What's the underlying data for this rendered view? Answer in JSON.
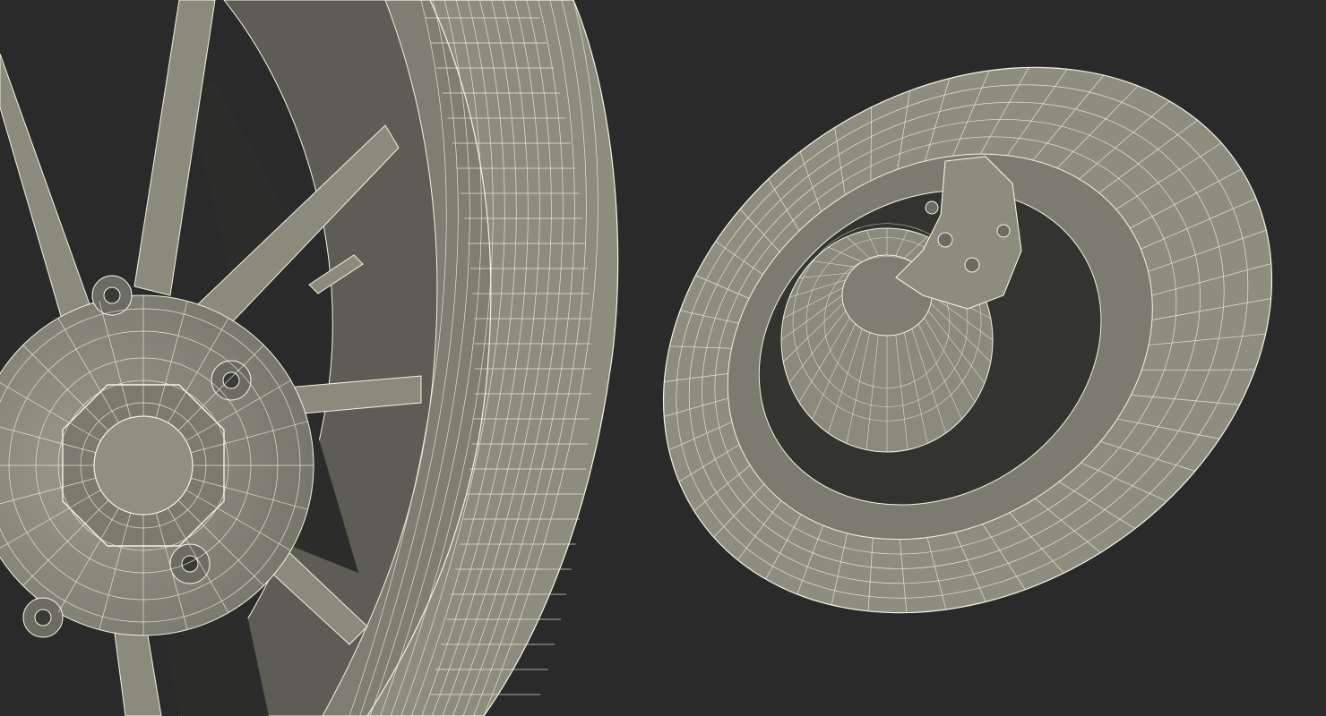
{
  "scene": {
    "background_color": "#2a2a2a",
    "surface_color": "#8e8e80",
    "surface_shadow_color": "#62625a",
    "surface_dark_color": "#4f4f49",
    "wire_color": "#f4f3e0"
  },
  "views": [
    {
      "name": "wheel-rim-closeup"
    },
    {
      "name": "wheel-tire-brake-assembly"
    }
  ]
}
